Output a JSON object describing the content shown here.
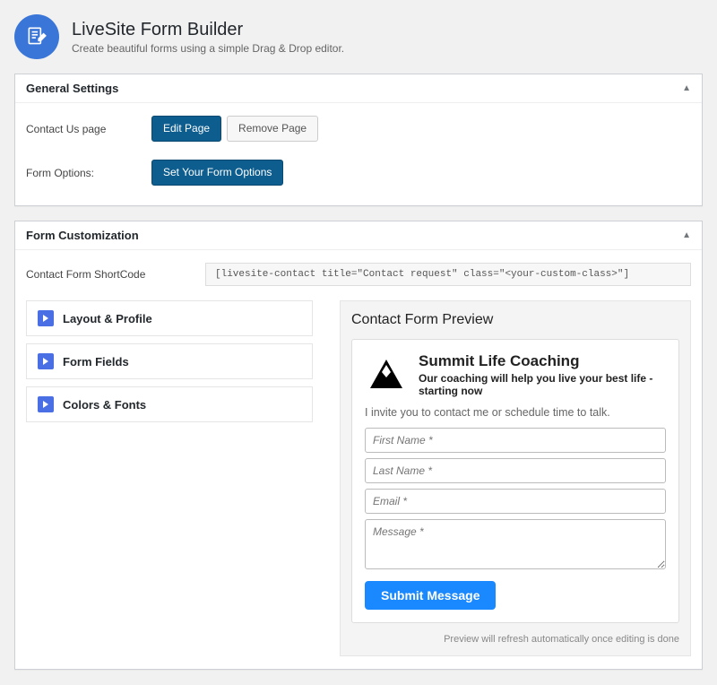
{
  "header": {
    "title": "LiveSite Form Builder",
    "subtitle": "Create beautiful forms using a simple Drag & Drop editor."
  },
  "panels": {
    "general": {
      "title": "General Settings",
      "rows": {
        "contact_page": {
          "label": "Contact Us page",
          "edit_btn": "Edit Page",
          "remove_btn": "Remove Page"
        },
        "form_options": {
          "label": "Form Options:",
          "set_btn": "Set Your Form Options"
        }
      }
    },
    "custom": {
      "title": "Form Customization",
      "shortcode": {
        "label": "Contact Form ShortCode",
        "value": "[livesite-contact title=\"Contact request\" class=\"<your-custom-class>\"]"
      },
      "accordion": [
        "Layout & Profile",
        "Form Fields",
        "Colors & Fonts"
      ],
      "preview": {
        "heading": "Contact Form Preview",
        "business": {
          "title": "Summit Life Coaching",
          "subtitle": "Our coaching will help you live your best life - starting now",
          "invite": "I invite you to contact me or schedule time to talk."
        },
        "fields": {
          "first_name": "First Name *",
          "last_name": "Last Name *",
          "email": "Email *",
          "message": "Message *"
        },
        "submit": "Submit Message",
        "note": "Preview will refresh automatically once editing is done"
      }
    }
  }
}
